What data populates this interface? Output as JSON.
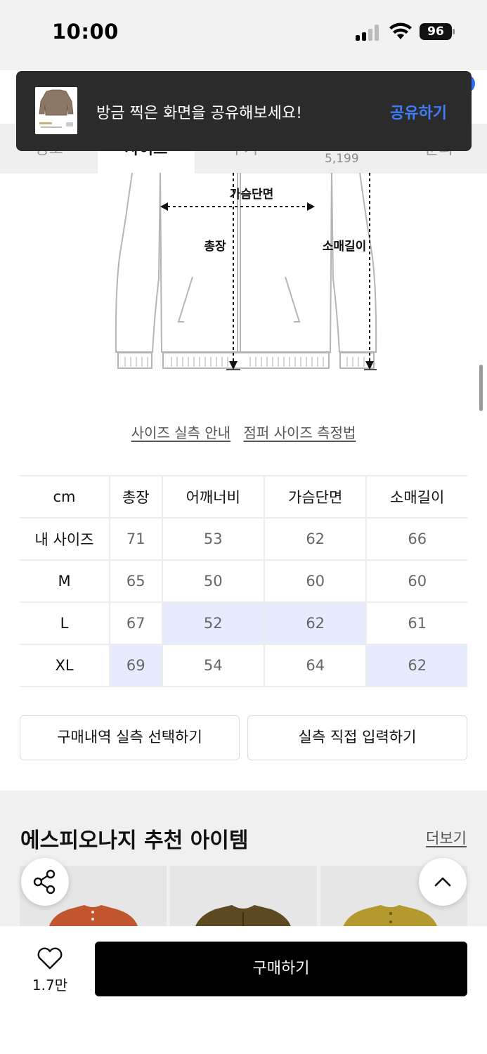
{
  "status_bar": {
    "time": "10:00",
    "battery": "96"
  },
  "tabs": [
    {
      "label": "정보"
    },
    {
      "label": "사이즈"
    },
    {
      "label": "후기",
      "count": "5,199"
    },
    {
      "label": "문의"
    }
  ],
  "toast": {
    "message": "방금 찍은 화면을 공유해보세요!",
    "action": "공유하기"
  },
  "diagram": {
    "chest_label": "가슴단면",
    "length_label": "총장",
    "sleeve_label": "소매길이"
  },
  "links": {
    "size_guide": "사이즈 실측 안내",
    "measure_method": "점퍼 사이즈 측정법"
  },
  "size_table": {
    "headers": [
      "cm",
      "총장",
      "어깨너비",
      "가슴단면",
      "소매길이"
    ],
    "rows": [
      {
        "label": "내 사이즈",
        "values": [
          "71",
          "53",
          "62",
          "66"
        ]
      },
      {
        "label": "M",
        "values": [
          "65",
          "50",
          "60",
          "60"
        ]
      },
      {
        "label": "L",
        "values": [
          "67",
          "52",
          "62",
          "61"
        ]
      },
      {
        "label": "XL",
        "values": [
          "69",
          "54",
          "64",
          "62"
        ]
      }
    ],
    "highlight_color": "#e6ecfd"
  },
  "buttons": {
    "select_purchase": "구매내역 실측 선택하기",
    "direct_input": "실측 직접 입력하기"
  },
  "recommendation": {
    "title": "에스피오나지 추천 아이템",
    "more": "더보기"
  },
  "bottom_bar": {
    "like_count": "1.7만",
    "buy_label": "구매하기"
  },
  "colors": {
    "accent": "#3f7cf5",
    "toast_bg": "#2b2b2b",
    "buy_bg": "#000000"
  }
}
